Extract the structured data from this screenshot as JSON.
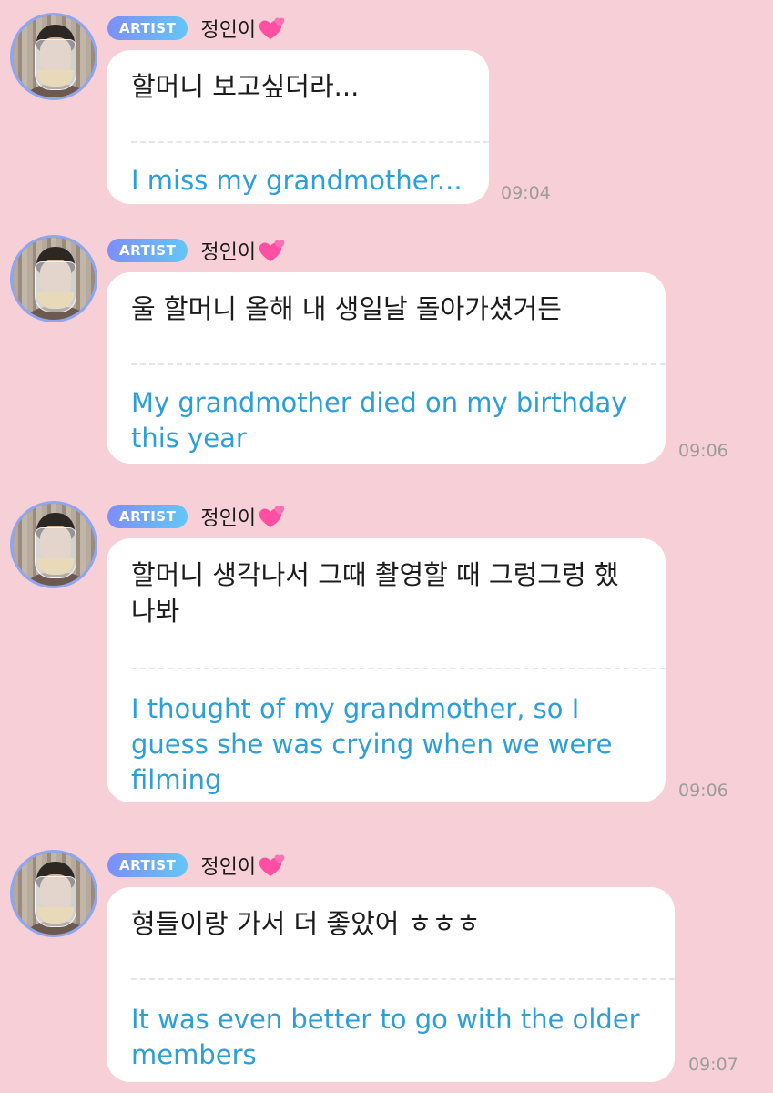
{
  "messages": [
    {
      "badge": "ARTIST",
      "name": "정인이",
      "korean": "할머니 보고싶더라...",
      "english": "I miss my grandmother...",
      "time": "09:04"
    },
    {
      "badge": "ARTIST",
      "name": "정인이",
      "korean": "울 할머니 올해 내 생일날 돌아가셨거든",
      "english": "My grandmother died on my birthday\nthis year",
      "time": "09:06"
    },
    {
      "badge": "ARTIST",
      "name": "정인이",
      "korean": "할머니 생각나서 그때 촬영할 때 그렁그렁 했\n나봐",
      "english": "I thought of my grandmother, so I\nguess she was crying when we were\nfilming",
      "time": "09:06"
    },
    {
      "badge": "ARTIST",
      "name": "정인이",
      "korean": "형들이랑 가서 더 좋았어 ㅎㅎㅎ",
      "english": "It was even better to go with the older\nmembers",
      "time": "09:07"
    }
  ],
  "colors": {
    "background": "#f7cfd7",
    "translation_text": "#2a9fd8",
    "badge_gradient_start": "#7e8ef8",
    "badge_gradient_end": "#63c6f5",
    "avatar_ring": "#8ea6f0"
  },
  "icons": {
    "heart": "two-hearts-emoji"
  }
}
